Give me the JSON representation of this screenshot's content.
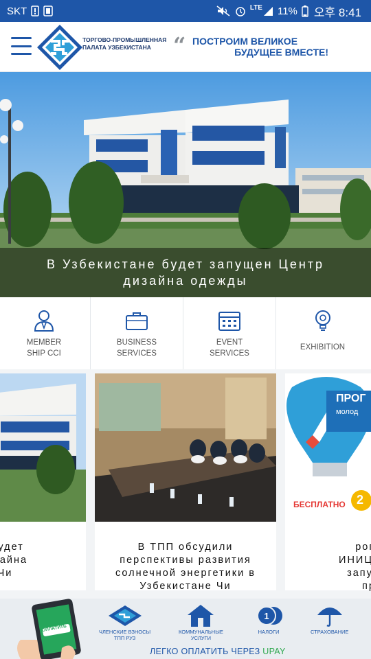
{
  "status_bar": {
    "carrier": "SKT",
    "network": "LTE",
    "battery": "11%",
    "time": "오후 8:41"
  },
  "header": {
    "org_name": "ТОРГОВО-ПРОМЫШЛЕННАЯ ПАЛАТА УЗБЕКИСТАНА",
    "slogan_line1": "ПОСТРОИМ ВЕЛИКОЕ",
    "slogan_line2": "БУДУЩЕЕ ВМЕСТЕ!",
    "brand_color": "#1e56a8"
  },
  "hero": {
    "caption_line1": "В Узбекистане будет запущен Центр",
    "caption_line2": "дизайна одежды"
  },
  "services": [
    {
      "line1": "MEMBER",
      "line2": "SHIP CCI",
      "icon": "member-icon"
    },
    {
      "line1": "BUSINESS",
      "line2": "SERVICES",
      "icon": "briefcase-icon"
    },
    {
      "line1": "EVENT",
      "line2": "SERVICES",
      "icon": "calendar-icon"
    },
    {
      "line1": "EXHIBITION",
      "line2": "",
      "icon": "lightbulb-icon"
    }
  ],
  "cards": [
    {
      "lines": [
        "ане будет",
        "тр дизайна",
        "ды Чи"
      ]
    },
    {
      "lines": [
        "В ТПП обсудили",
        "перспективы развития",
        "солнечной энергетики в",
        "Узбекистане Чи"
      ]
    },
    {
      "lines": [
        "рограм",
        "ИНИЦИАТИВ",
        "запустить",
        "прое"
      ],
      "image_text_1": "ПРОГ",
      "image_text_2": "молод",
      "image_text_3": "БЕСПЛАТНО",
      "image_text_4": "2"
    }
  ],
  "banner": {
    "phone_button": "ОПЛАТИТЬ",
    "items": [
      {
        "label_line1": "ЧЛЕНСКИЕ ВЗНОСЫ",
        "label_line2": "ТПП РУЗ",
        "icon": "cci-logo-icon"
      },
      {
        "label_line1": "КОММУНАЛЬНЫЕ",
        "label_line2": "УСЛУГИ",
        "icon": "house-icon"
      },
      {
        "label_line1": "НАЛОГИ",
        "label_line2": "",
        "icon": "coins-icon"
      },
      {
        "label_line1": "СТРАХОВАНИЕ",
        "label_line2": "",
        "icon": "umbrella-icon"
      }
    ],
    "tagline_prefix": "ЛЕГКО ОПЛАТИТЬ ЧЕРЕЗ ",
    "tagline_brand": "UPAY"
  }
}
